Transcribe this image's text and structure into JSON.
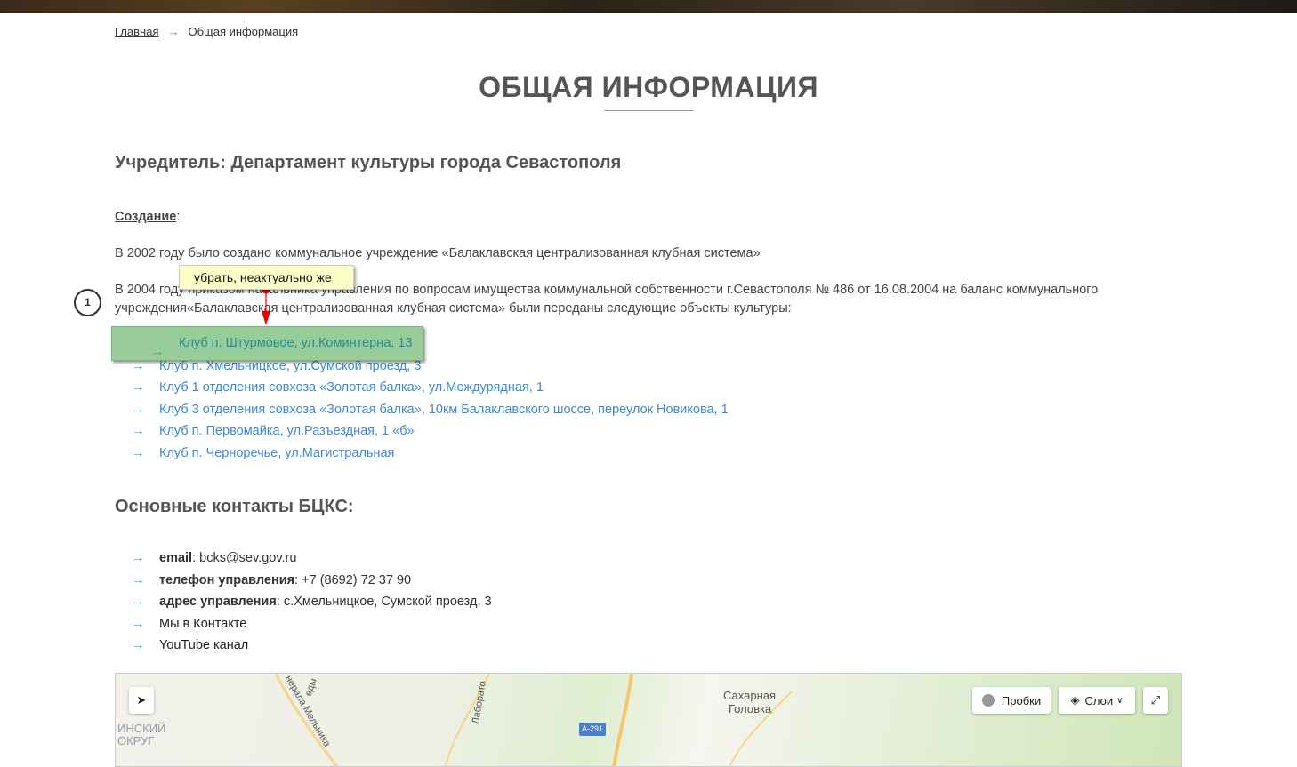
{
  "breadcrumb": {
    "home": "Главная",
    "sep": "→",
    "current": "Общая информация"
  },
  "title": "ОБЩАЯ ИНФОРМАЦИЯ",
  "founder": "Учредитель: Департамент культуры города Севастополя",
  "creation_label": "Создание",
  "creation_colon": ":",
  "para1": "В  2002  году было создано коммунальное учреждение «Балаклавская централизованная клубная система»",
  "para2": "В 2004 году приказом начальника управления по вопросам имущества  коммунальной собственности г.Севастополя № 486 от 16.08.2004 на баланс коммунального учреждения«Балаклавская централизованная клубная система» были переданы следующие объекты культуры:",
  "objects": [
    "Клуб п. Штурмовое, ул.Коминтерна, 13",
    "Клуб п. Хмельницкое, ул.Сумской проезд, 3",
    "Клуб 1 отделения совхоза «Золотая балка», ул.Междурядная, 1",
    "Клуб 3 отделения совхоза «Золотая балка», 10км Балаклавского шоссе, переулок Новикова, 1",
    "Клуб п. Первомайка, ул.Разъездная, 1 «б»",
    "Клуб п. Черноречье, ул.Магистральная"
  ],
  "arrow": "→",
  "contacts_title": "Основные контакты БЦКС:",
  "contacts": [
    {
      "label": "email",
      "value": ": bcks@sev.gov.ru"
    },
    {
      "label": "телефон управления",
      "value": ": +7 (8692) 72 37 90"
    },
    {
      "label": "адрес управления",
      "value": ": с.Хмельницкое, Сумской проезд, 3"
    }
  ],
  "links": [
    "Мы в Контакте",
    "YouTube канал"
  ],
  "annotation": {
    "note": "убрать, неактуально же",
    "number": "1"
  },
  "map": {
    "traffic": "Пробки",
    "layers": "Слои",
    "labels": [
      "Сахарная",
      "Головка",
      "ИНСКИЙ",
      "ОКРУГ",
      "Лаборато",
      "нерала Мельника",
      "еды"
    ],
    "road": "А-291"
  }
}
